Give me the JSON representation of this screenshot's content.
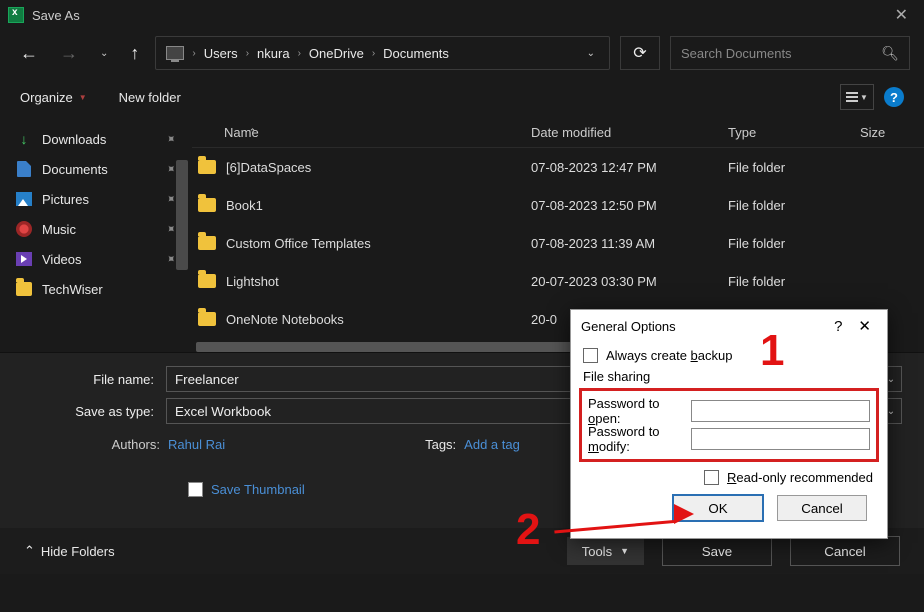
{
  "titlebar": {
    "title": "Save As"
  },
  "nav": {
    "breadcrumbs": [
      "Users",
      "nkura",
      "OneDrive",
      "Documents"
    ],
    "search_placeholder": "Search Documents"
  },
  "toolbar": {
    "organize": "Organize",
    "new_folder": "New folder"
  },
  "sidebar": {
    "items": [
      {
        "label": "Downloads",
        "icon": "download"
      },
      {
        "label": "Documents",
        "icon": "document"
      },
      {
        "label": "Pictures",
        "icon": "picture"
      },
      {
        "label": "Music",
        "icon": "music"
      },
      {
        "label": "Videos",
        "icon": "video"
      },
      {
        "label": "TechWiser",
        "icon": "folder"
      }
    ]
  },
  "columns": {
    "name": "Name",
    "date": "Date modified",
    "type": "Type",
    "size": "Size"
  },
  "files": [
    {
      "name": "[6]DataSpaces",
      "date": "07-08-2023 12:47 PM",
      "type": "File folder"
    },
    {
      "name": "Book1",
      "date": "07-08-2023 12:50 PM",
      "type": "File folder"
    },
    {
      "name": "Custom Office Templates",
      "date": "07-08-2023 11:39 AM",
      "type": "File folder"
    },
    {
      "name": "Lightshot",
      "date": "20-07-2023 03:30 PM",
      "type": "File folder"
    },
    {
      "name": "OneNote Notebooks",
      "date": "20-0",
      "type": ""
    }
  ],
  "form": {
    "file_name_label": "File name:",
    "file_name_value": "Freelancer",
    "save_type_label": "Save as type:",
    "save_type_value": "Excel Workbook",
    "authors_label": "Authors:",
    "authors_value": "Rahul Rai",
    "tags_label": "Tags:",
    "tags_value": "Add a tag",
    "thumb_label": "Save Thumbnail"
  },
  "footer": {
    "hide_folders": "Hide Folders",
    "tools": "Tools",
    "save": "Save",
    "cancel": "Cancel"
  },
  "modal": {
    "title": "General Options",
    "always_backup": "Always create backup",
    "always_backup_key": "b",
    "file_sharing": "File sharing",
    "pw_open_pre": "Password to ",
    "pw_open_key": "o",
    "pw_open_post": "pen:",
    "pw_modify_pre": "Password to ",
    "pw_modify_key": "m",
    "pw_modify_post": "odify:",
    "readonly_pre": "",
    "readonly_key": "R",
    "readonly_post": "ead-only recommended",
    "ok": "OK",
    "cancel": "Cancel"
  },
  "annotations": {
    "one": "1",
    "two": "2"
  }
}
